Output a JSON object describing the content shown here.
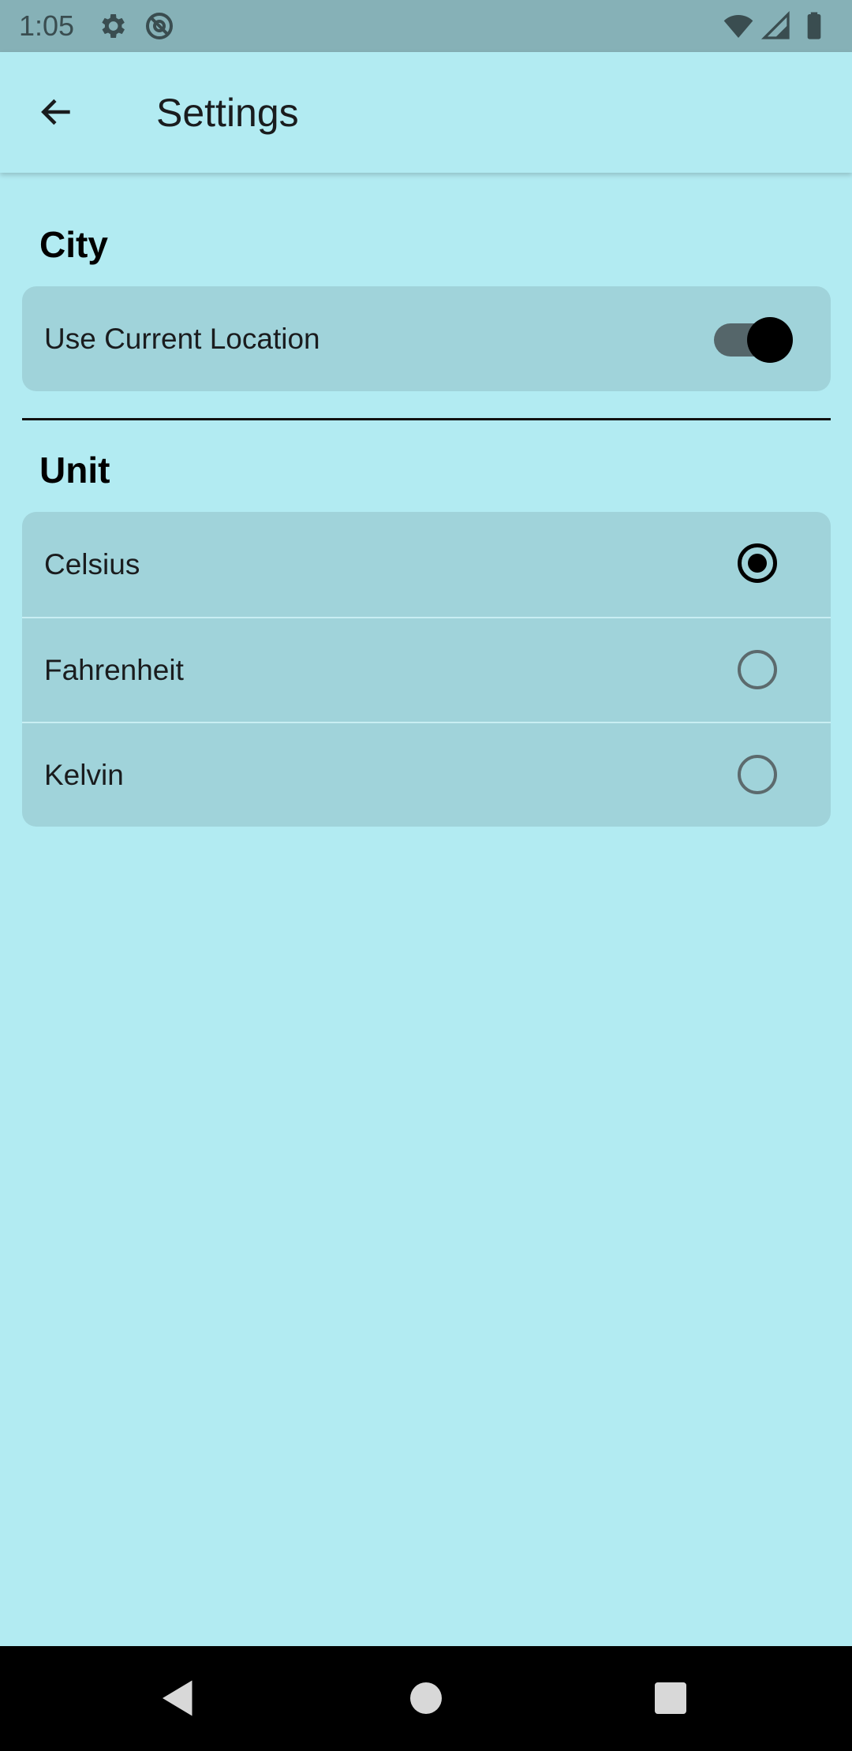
{
  "status_bar": {
    "time": "1:05",
    "left_icons": [
      "gear-icon",
      "at-sign-icon"
    ],
    "right_icons": [
      "wifi-icon",
      "cellular-signal-icon",
      "battery-icon"
    ]
  },
  "app_bar": {
    "back_icon": "arrow-left-icon",
    "title": "Settings"
  },
  "city_section": {
    "title": "City",
    "use_current_location": {
      "label": "Use Current Location",
      "enabled": true
    }
  },
  "unit_section": {
    "title": "Unit",
    "options": [
      {
        "label": "Celsius",
        "selected": true
      },
      {
        "label": "Fahrenheit",
        "selected": false
      },
      {
        "label": "Kelvin",
        "selected": false
      }
    ]
  },
  "nav_bar": {
    "buttons": [
      "back-triangle-icon",
      "home-circle-icon",
      "recents-square-icon"
    ]
  },
  "colors": {
    "background": "#b2ebf2",
    "card": "#a0d3da",
    "status_bar": "#86b1b7",
    "toggle_track": "#55666a",
    "accent": "#000000"
  }
}
